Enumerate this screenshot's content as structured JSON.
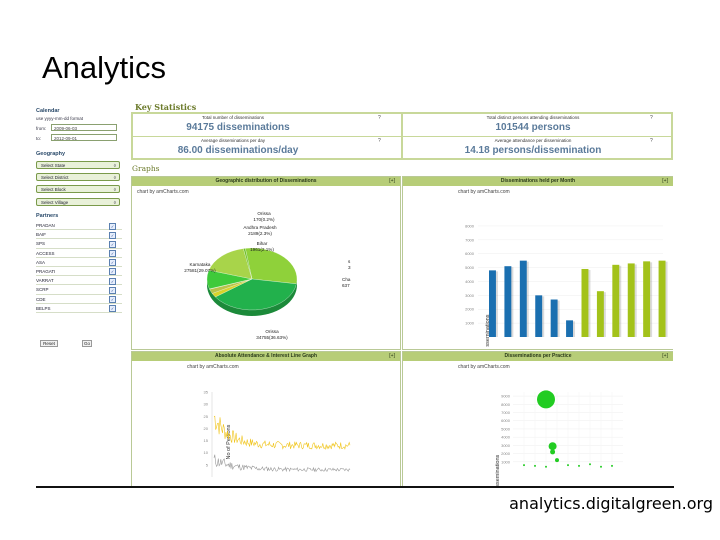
{
  "slide": {
    "title": "Analytics",
    "url": "analytics.digitalgreen.org"
  },
  "sidebar": {
    "calendar_title": "Calendar",
    "date_format_hint": "use yyyy-mm-dd format",
    "from_label": "from:",
    "from_value": "2009-06-03",
    "to_label": "to:",
    "to_value": "2012-09-01",
    "geography_title": "Geography",
    "selects": [
      "Select State",
      "Select District",
      "Select Block",
      "Select Village"
    ],
    "partners_title": "Partners",
    "partners": [
      "PRADAN",
      "BAIF",
      "SPS",
      "ACCESS",
      "ASA",
      "PRAGATI",
      "VARRAT",
      "SCRP",
      "CDE",
      "BELPS"
    ],
    "reset_label": "Reset",
    "go_label": "Go"
  },
  "key_stats": {
    "title": "Key Statistics",
    "items": [
      {
        "label": "Total number of disseminations",
        "value": "94175 disseminations"
      },
      {
        "label": "Total distinct persons attending disseminations",
        "value": "101544 persons"
      },
      {
        "label": "Average disseminations per day",
        "value": "86.00 disseminations/day"
      },
      {
        "label": "Average attendance per dissemination",
        "value": "14.18 persons/dissemination"
      }
    ],
    "help_icon_text": "?"
  },
  "graphs": {
    "title": "Graphs",
    "credit": "chart by amCharts.com",
    "toggle": "[+]",
    "panels": [
      "Geographic distribution of Disseminations",
      "Disseminations held per Month",
      "Absolute Attendance & Interest Line Graph",
      "Disseminations per Practice"
    ]
  },
  "chart_data": [
    {
      "type": "pie",
      "title": "Geographic distribution of Disseminations",
      "slices": [
        {
          "label": "Karnataka",
          "text": "Karnataka\n27581(29.07%)",
          "value": 27581,
          "color": "#8fd13a"
        },
        {
          "label": "Orissa",
          "text": "Orissa\n34755(36.63%)",
          "value": 34755,
          "color": "#22b14c"
        },
        {
          "label": "Bihar",
          "text": "Bihar\n1961(2.1%)",
          "value": 1961,
          "color": "#d9d42a"
        },
        {
          "label": "Andhra Pradesh",
          "text": "Andhra Pradesh\n2189(2.3%)",
          "value": 2189,
          "color": "#b9c34a"
        },
        {
          "label": "Orissa",
          "text": "Orissa\n170(0.2%)",
          "value": 170,
          "color": "#e0e070"
        },
        {
          "label": "",
          "value": 9000,
          "color": "#3fca3a"
        },
        {
          "label": "",
          "value": 16000,
          "color": "#a8d44a"
        },
        {
          "label": "Cha",
          "text": "Cha\n637",
          "value": 637,
          "color": "#6fbf2a"
        }
      ]
    },
    {
      "type": "bar",
      "title": "Disseminations held per Month",
      "ylabel": "No. of Disseminations",
      "yticks": [
        "8000",
        "7000",
        "6000",
        "5000",
        "4000",
        "3000",
        "2000",
        "1000"
      ],
      "series": [
        {
          "values": [
            4800,
            5100,
            5500,
            3000,
            2700,
            1200,
            0,
            0,
            0,
            0,
            0,
            0
          ],
          "color": "#1a6fb0"
        },
        {
          "values": [
            0,
            0,
            0,
            0,
            0,
            0,
            4900,
            3300,
            5200,
            5300,
            5450,
            5500
          ],
          "color": "#a3c21a"
        }
      ]
    },
    {
      "type": "line",
      "title": "Absolute Attendance & Interest Line Graph",
      "ylabel": "No of Persons",
      "yticks": [
        35,
        30,
        25,
        20,
        15,
        10,
        5
      ],
      "ylim": [
        0,
        35
      ],
      "series": [
        {
          "color": "#f0c419"
        },
        {
          "color": "#999999"
        }
      ]
    },
    {
      "type": "scatter",
      "title": "Disseminations per Practice",
      "ylabel": "Disseminations",
      "yticks": [
        "9000",
        "8000",
        "7000",
        "6000",
        "5000",
        "4000",
        "3000",
        "2000",
        "1000"
      ],
      "points": [
        {
          "x": 3,
          "y": 8600,
          "size": 9
        },
        {
          "x": 3.6,
          "y": 2900,
          "size": 4
        },
        {
          "x": 3.6,
          "y": 2200,
          "size": 2.5
        },
        {
          "x": 4,
          "y": 1200,
          "size": 2
        },
        {
          "x": 1,
          "y": 600,
          "size": 1
        },
        {
          "x": 2,
          "y": 500,
          "size": 1
        },
        {
          "x": 3,
          "y": 400,
          "size": 1
        },
        {
          "x": 5,
          "y": 600,
          "size": 1
        },
        {
          "x": 6,
          "y": 500,
          "size": 1
        },
        {
          "x": 7,
          "y": 700,
          "size": 1
        },
        {
          "x": 8,
          "y": 400,
          "size": 1
        },
        {
          "x": 9,
          "y": 500,
          "size": 1
        }
      ]
    }
  ]
}
